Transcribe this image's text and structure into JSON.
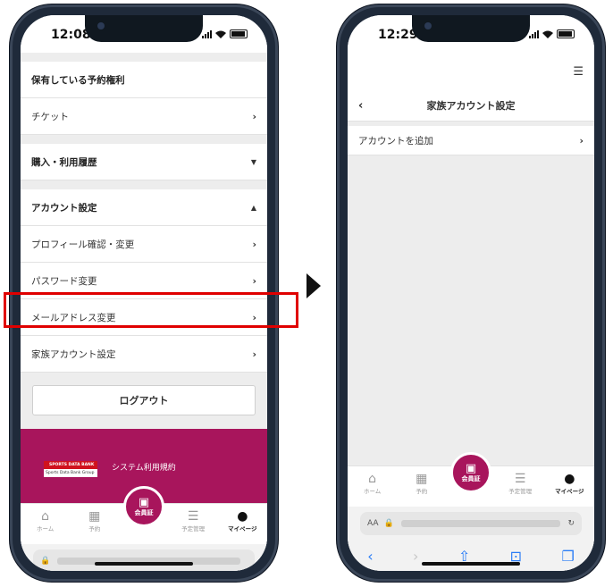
{
  "left": {
    "time": "12:08",
    "sections": {
      "reservations": "保有している予約権利",
      "ticket": "チケット",
      "history": "購入・利用履歴",
      "account": "アカウント設定",
      "profile": "プロフィール確認・変更",
      "password": "パスワード変更",
      "email": "メールアドレス変更",
      "family": "家族アカウント設定"
    },
    "logout": "ログアウト",
    "footer_link": "システム利用規約",
    "logo_line1": "SPORTS DATA BANK",
    "logo_line2": "Sports Data Bank Group"
  },
  "right": {
    "time": "12:29",
    "header_title": "家族アカウント設定",
    "add_account": "アカウントを追加"
  },
  "tabs": {
    "home": "ホーム",
    "reserve": "予約",
    "member": "会員証",
    "schedule": "予定管理",
    "mypage": "マイページ"
  },
  "browser": {
    "aa": "AA"
  },
  "colors": {
    "brand": "#a8155c",
    "highlight": "#e00000",
    "link_blue": "#2a7df6"
  }
}
